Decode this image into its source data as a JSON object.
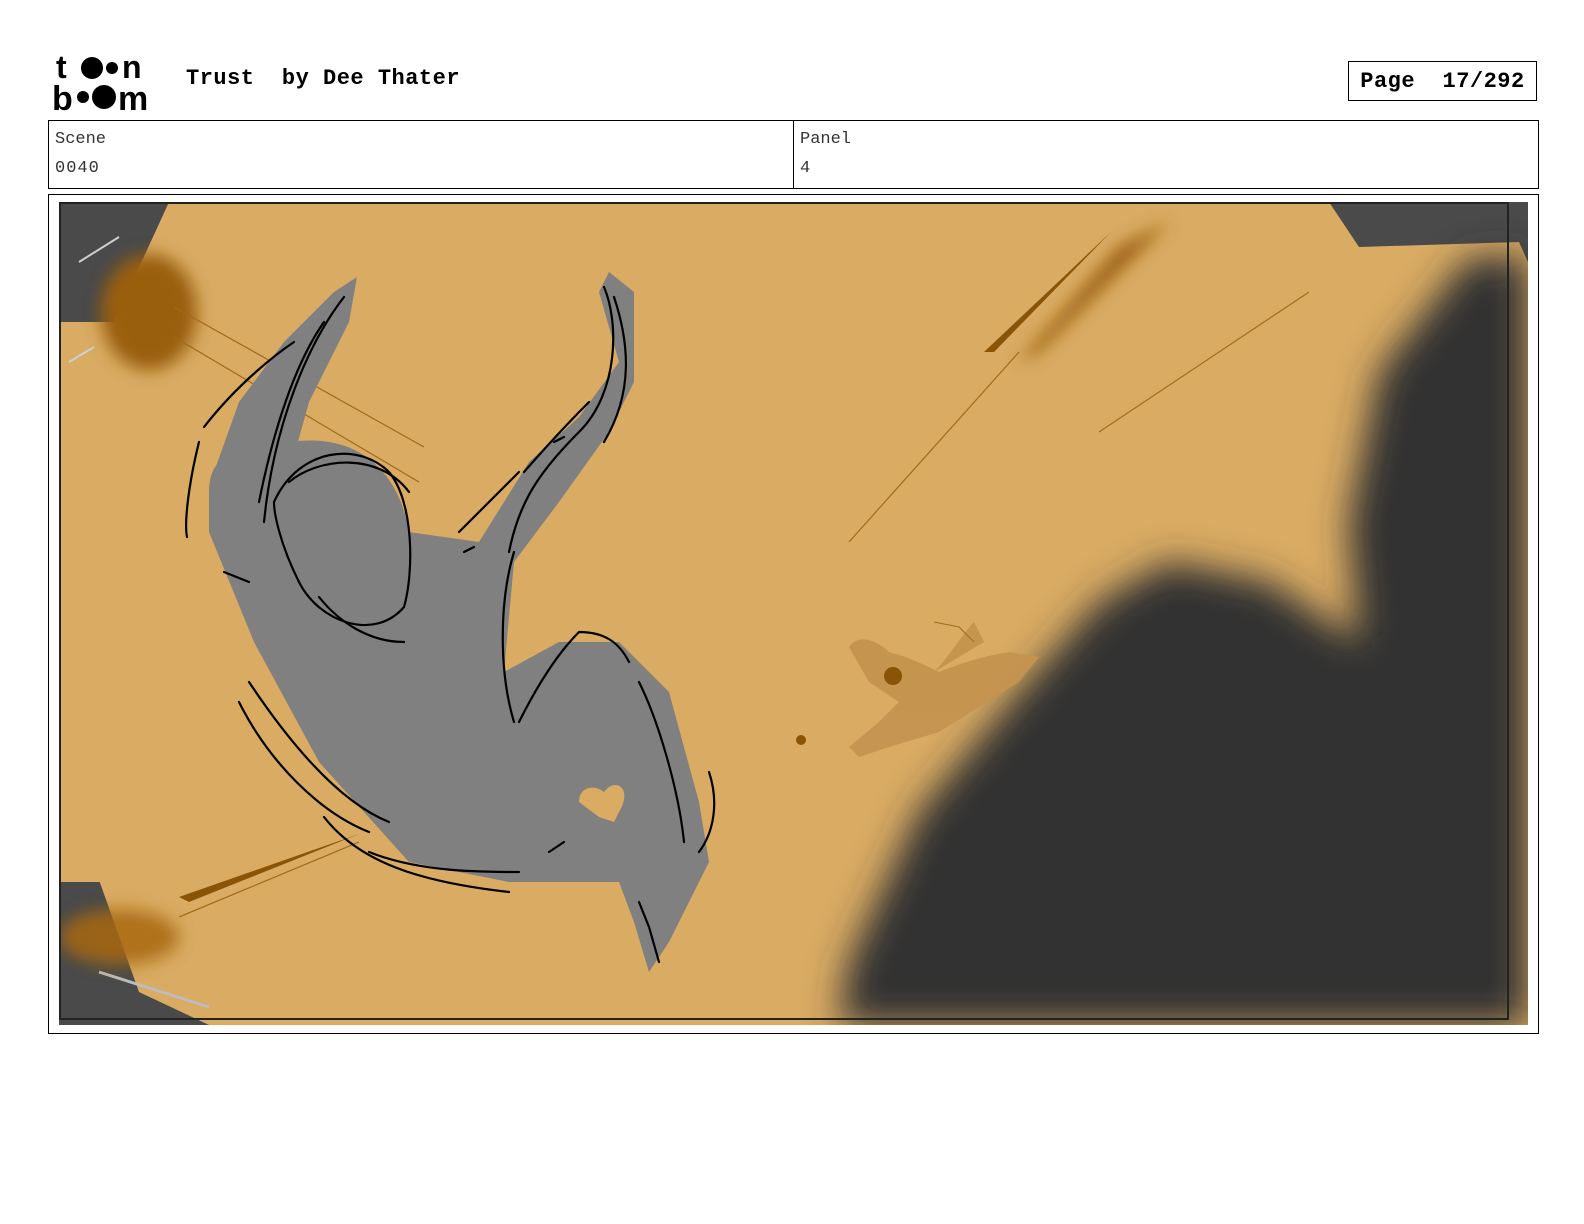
{
  "header": {
    "logo_text": "toon boom",
    "title": "Trust  by Dee Thater",
    "page_label": "Page  17/292"
  },
  "info": {
    "scene_label": "Scene",
    "scene_value": "0040",
    "panel_label": "Panel",
    "panel_value": "4"
  },
  "panel_image": {
    "description_icon": "storyboard-panel-image",
    "colors": {
      "background": "#d9ab63",
      "figure": "#808080",
      "shadow": "#333333",
      "accent": "#9a5f0a"
    }
  }
}
